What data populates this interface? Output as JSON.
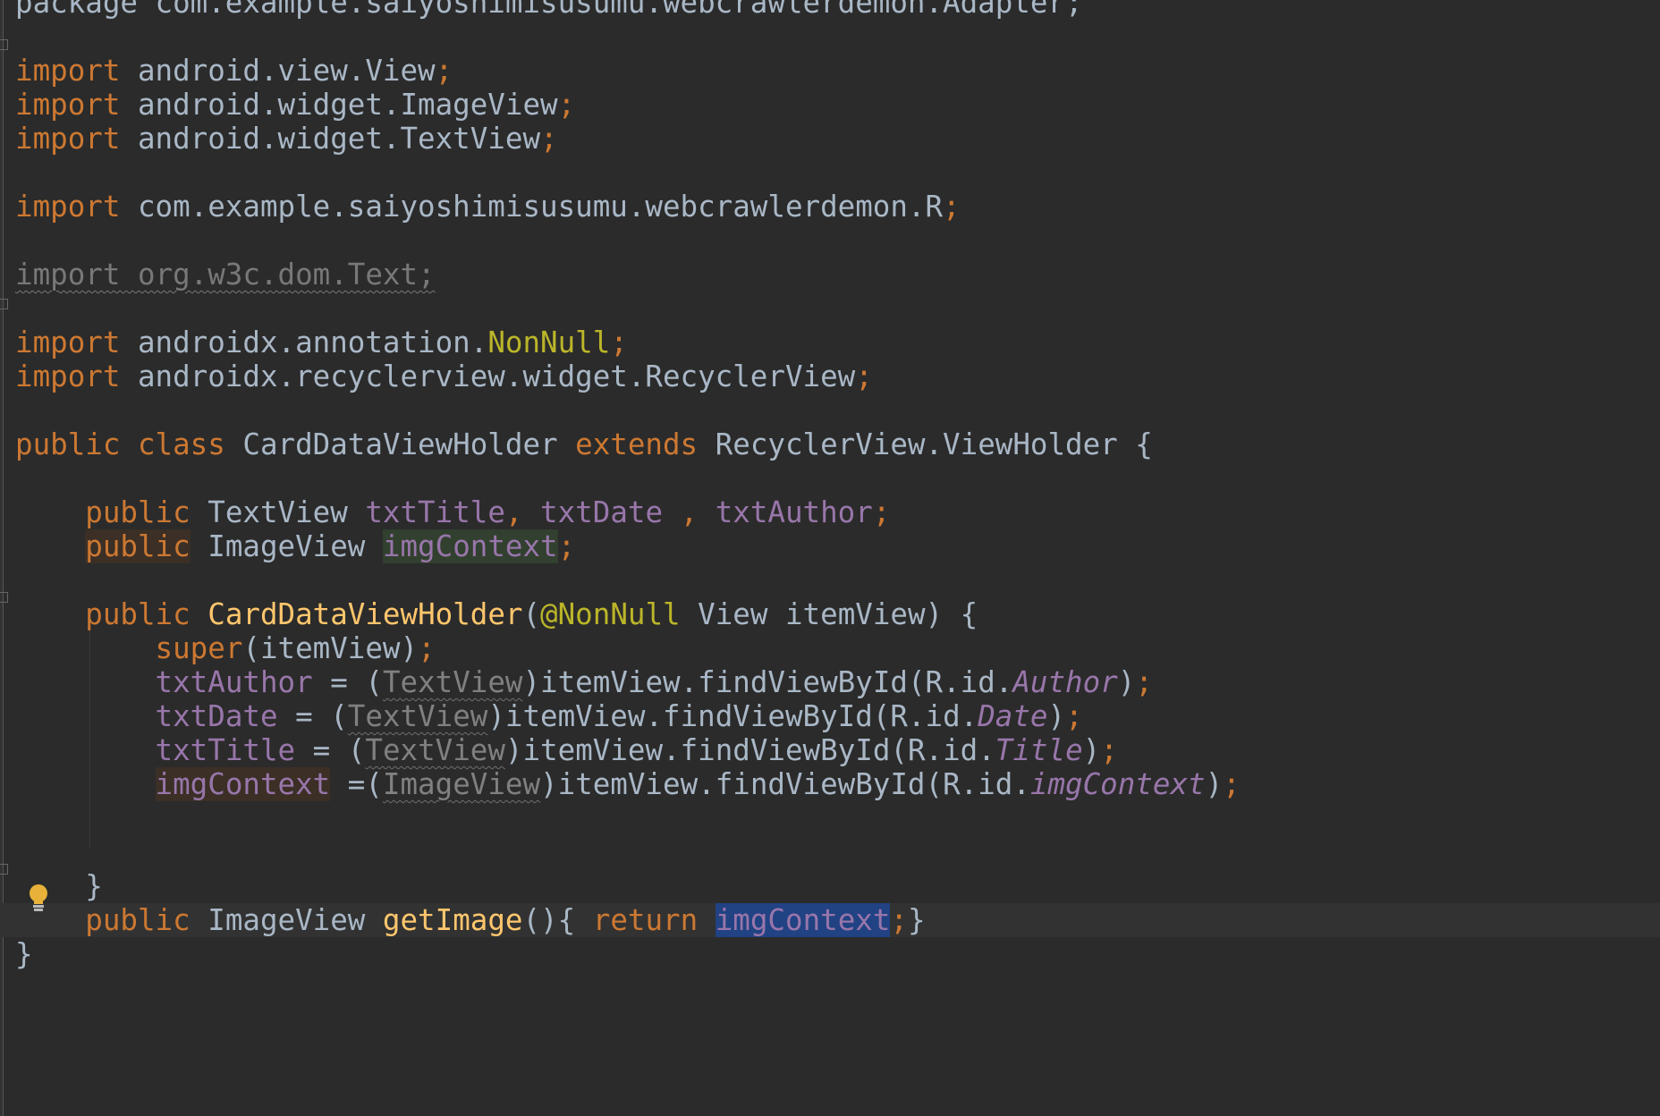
{
  "editor": {
    "lines": [
      {
        "id": "pkg",
        "tokens": [
          {
            "t": "package com.example.saiyoshimisusumu.webcrawlerdemon.Adapter;",
            "c": "plain"
          }
        ]
      },
      {
        "id": "blank0",
        "tokens": []
      },
      {
        "id": "import-view",
        "tokens": [
          {
            "t": "import",
            "c": "kw"
          },
          {
            "t": " android.view.View",
            "c": "plain"
          },
          {
            "t": ";",
            "c": "semi"
          }
        ]
      },
      {
        "id": "import-imageview",
        "tokens": [
          {
            "t": "import",
            "c": "kw"
          },
          {
            "t": " android.widget.ImageView",
            "c": "plain"
          },
          {
            "t": ";",
            "c": "semi"
          }
        ]
      },
      {
        "id": "import-textview",
        "tokens": [
          {
            "t": "import",
            "c": "kw"
          },
          {
            "t": " android.widget.TextView",
            "c": "plain"
          },
          {
            "t": ";",
            "c": "semi"
          }
        ]
      },
      {
        "id": "blank1",
        "tokens": []
      },
      {
        "id": "import-r",
        "tokens": [
          {
            "t": "import",
            "c": "kw"
          },
          {
            "t": " com.example.saiyoshimisusumu.webcrawlerdemon.R",
            "c": "plain"
          },
          {
            "t": ";",
            "c": "semi"
          }
        ]
      },
      {
        "id": "blank2",
        "tokens": []
      },
      {
        "id": "import-text-unused",
        "tokens": [
          {
            "t": "import org.w3c.dom.Text;",
            "c": "unused"
          }
        ]
      },
      {
        "id": "blank3",
        "tokens": []
      },
      {
        "id": "import-nonnull",
        "tokens": [
          {
            "t": "import",
            "c": "kw"
          },
          {
            "t": " androidx.annotation.",
            "c": "plain"
          },
          {
            "t": "NonNull",
            "c": "ann"
          },
          {
            "t": ";",
            "c": "semi"
          }
        ]
      },
      {
        "id": "import-recyclerview",
        "tokens": [
          {
            "t": "import",
            "c": "kw"
          },
          {
            "t": " androidx.recyclerview.widget.RecyclerView",
            "c": "plain"
          },
          {
            "t": ";",
            "c": "semi"
          }
        ]
      },
      {
        "id": "blank4",
        "tokens": []
      },
      {
        "id": "class-decl",
        "tokens": [
          {
            "t": "public class",
            "c": "kw"
          },
          {
            "t": " CardDataViewHolder ",
            "c": "plain"
          },
          {
            "t": "extends",
            "c": "kw"
          },
          {
            "t": " RecyclerView.ViewHolder {",
            "c": "plain"
          }
        ]
      },
      {
        "id": "blank5",
        "tokens": []
      },
      {
        "id": "field-textviews",
        "tokens": [
          {
            "t": "    ",
            "c": "plain"
          },
          {
            "t": "public",
            "c": "kw"
          },
          {
            "t": " TextView ",
            "c": "plain"
          },
          {
            "t": "txtTitle",
            "c": "fld"
          },
          {
            "t": ", ",
            "c": "semi"
          },
          {
            "t": "txtDate",
            "c": "fld"
          },
          {
            "t": " , ",
            "c": "semi"
          },
          {
            "t": "txtAuthor",
            "c": "fld"
          },
          {
            "t": ";",
            "c": "semi"
          }
        ]
      },
      {
        "id": "field-imageview",
        "tokens": [
          {
            "t": "    ",
            "c": "plain"
          },
          {
            "t": "public",
            "c": "kw hl-brown"
          },
          {
            "t": " ImageView ",
            "c": "plain"
          },
          {
            "t": "imgContext",
            "c": "fld hl-green"
          },
          {
            "t": ";",
            "c": "semi"
          }
        ]
      },
      {
        "id": "blank6",
        "tokens": []
      },
      {
        "id": "ctor-decl",
        "tokens": [
          {
            "t": "    ",
            "c": "plain"
          },
          {
            "t": "public",
            "c": "kw"
          },
          {
            "t": " ",
            "c": "plain"
          },
          {
            "t": "CardDataViewHolder",
            "c": "mth"
          },
          {
            "t": "(",
            "c": "plain"
          },
          {
            "t": "@NonNull",
            "c": "ann"
          },
          {
            "t": " View itemView) {",
            "c": "plain"
          }
        ]
      },
      {
        "id": "ctor-super",
        "tokens": [
          {
            "t": "        ",
            "c": "plain"
          },
          {
            "t": "super",
            "c": "kw"
          },
          {
            "t": "(itemView)",
            "c": "plain"
          },
          {
            "t": ";",
            "c": "semi"
          }
        ]
      },
      {
        "id": "ctor-author",
        "tokens": [
          {
            "t": "        ",
            "c": "plain"
          },
          {
            "t": "txtAuthor",
            "c": "fld"
          },
          {
            "t": " = (",
            "c": "plain"
          },
          {
            "t": "TextView",
            "c": "redundant"
          },
          {
            "t": ")itemView.findViewById(R.id.",
            "c": "plain"
          },
          {
            "t": "Author",
            "c": "fld-i"
          },
          {
            "t": ")",
            "c": "plain"
          },
          {
            "t": ";",
            "c": "semi"
          }
        ]
      },
      {
        "id": "ctor-date",
        "tokens": [
          {
            "t": "        ",
            "c": "plain"
          },
          {
            "t": "txtDate",
            "c": "fld"
          },
          {
            "t": " = (",
            "c": "plain"
          },
          {
            "t": "TextView",
            "c": "redundant"
          },
          {
            "t": ")itemView.findViewById(R.id.",
            "c": "plain"
          },
          {
            "t": "Date",
            "c": "fld-i"
          },
          {
            "t": ")",
            "c": "plain"
          },
          {
            "t": ";",
            "c": "semi"
          }
        ]
      },
      {
        "id": "ctor-title",
        "tokens": [
          {
            "t": "        ",
            "c": "plain"
          },
          {
            "t": "txtTitle",
            "c": "fld"
          },
          {
            "t": " = (",
            "c": "plain"
          },
          {
            "t": "TextView",
            "c": "redundant"
          },
          {
            "t": ")itemView.findViewById(R.id.",
            "c": "plain"
          },
          {
            "t": "Title",
            "c": "fld-i"
          },
          {
            "t": ")",
            "c": "plain"
          },
          {
            "t": ";",
            "c": "semi"
          }
        ]
      },
      {
        "id": "ctor-img",
        "tokens": [
          {
            "t": "        ",
            "c": "plain"
          },
          {
            "t": "imgContext",
            "c": "fld hl-brown"
          },
          {
            "t": " =(",
            "c": "plain"
          },
          {
            "t": "ImageView",
            "c": "redundant"
          },
          {
            "t": ")itemView.findViewById(R.id.",
            "c": "plain"
          },
          {
            "t": "imgContext",
            "c": "fld-i"
          },
          {
            "t": ")",
            "c": "plain"
          },
          {
            "t": ";",
            "c": "semi"
          }
        ]
      },
      {
        "id": "blank7",
        "tokens": []
      },
      {
        "id": "blank8",
        "tokens": []
      },
      {
        "id": "ctor-close",
        "tokens": [
          {
            "t": "    }",
            "c": "plain"
          }
        ]
      },
      {
        "id": "getter",
        "caret": true,
        "tokens": [
          {
            "t": "    ",
            "c": "plain"
          },
          {
            "t": "public",
            "c": "kw"
          },
          {
            "t": " ImageView ",
            "c": "plain"
          },
          {
            "t": "getImage",
            "c": "mth"
          },
          {
            "t": "(){ ",
            "c": "plain"
          },
          {
            "t": "return",
            "c": "kw"
          },
          {
            "t": " ",
            "c": "plain"
          },
          {
            "t": "imgContext",
            "c": "fld hl-sel"
          },
          {
            "t": ";",
            "c": "semi"
          },
          {
            "t": "}",
            "c": "plain"
          }
        ]
      },
      {
        "id": "class-close",
        "tokens": [
          {
            "t": "}",
            "c": "plain"
          }
        ]
      }
    ],
    "intention_icon": "lightbulb-icon",
    "colors": {
      "background": "#2b2b2b",
      "keyword": "#cc7832",
      "annotation": "#bbb529",
      "field": "#9876aa",
      "method": "#ffc66d",
      "text": "#a9b7c6",
      "selection": "#214283",
      "bulb": "#e8b13a"
    }
  }
}
